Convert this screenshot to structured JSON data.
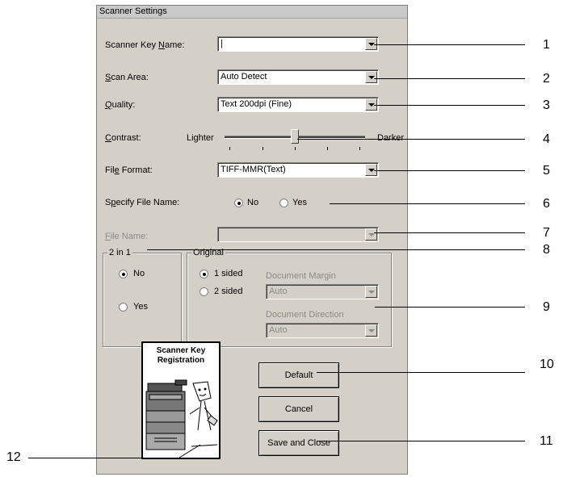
{
  "window": {
    "title": "Scanner Settings"
  },
  "fields": {
    "scanner_key_name": {
      "label_pre": "Scanner Key ",
      "label_u": "N",
      "label_post": "ame:",
      "value": "|"
    },
    "scan_area": {
      "label_pre": "",
      "label_u": "S",
      "label_post": "can Area:",
      "value": "Auto Detect"
    },
    "quality": {
      "label_pre": "",
      "label_u": "Q",
      "label_post": "uality:",
      "value": "Text 200dpi (Fine)"
    },
    "contrast": {
      "label_pre": "",
      "label_u": "C",
      "label_post": "ontrast:",
      "left_label": "Lighter",
      "right_label": "Darker",
      "level_fraction": 0.5
    },
    "file_format": {
      "label_pre": "Fil",
      "label_u": "e",
      "label_post": " Format:",
      "value": "TIFF-MMR(Text)"
    },
    "specify_file_name": {
      "label_pre": "S",
      "label_u": "p",
      "label_post": "ecify File Name:",
      "options": [
        "No",
        "Yes"
      ],
      "selected": "No"
    },
    "file_name": {
      "label_pre": "",
      "label_u": "F",
      "label_post": "ile Name:",
      "value": ""
    }
  },
  "two_in_one": {
    "title": "2 in 1",
    "options": [
      "No",
      "Yes"
    ],
    "selected": "No"
  },
  "original": {
    "title": "Original",
    "options": [
      "1 sided",
      "2 sided"
    ],
    "selected": "1 sided",
    "document_margin": {
      "label": "Document Margin",
      "value": "Auto"
    },
    "document_direction": {
      "label": "Document Direction",
      "value": "Auto"
    }
  },
  "registration": {
    "title_line1": "Scanner Key",
    "title_line2": "Registration"
  },
  "buttons": {
    "default": "Default",
    "cancel": "Cancel",
    "save_close": "Save and Close"
  },
  "callouts": [
    "1",
    "2",
    "3",
    "4",
    "5",
    "6",
    "7",
    "8",
    "9",
    "10",
    "11",
    "12"
  ]
}
